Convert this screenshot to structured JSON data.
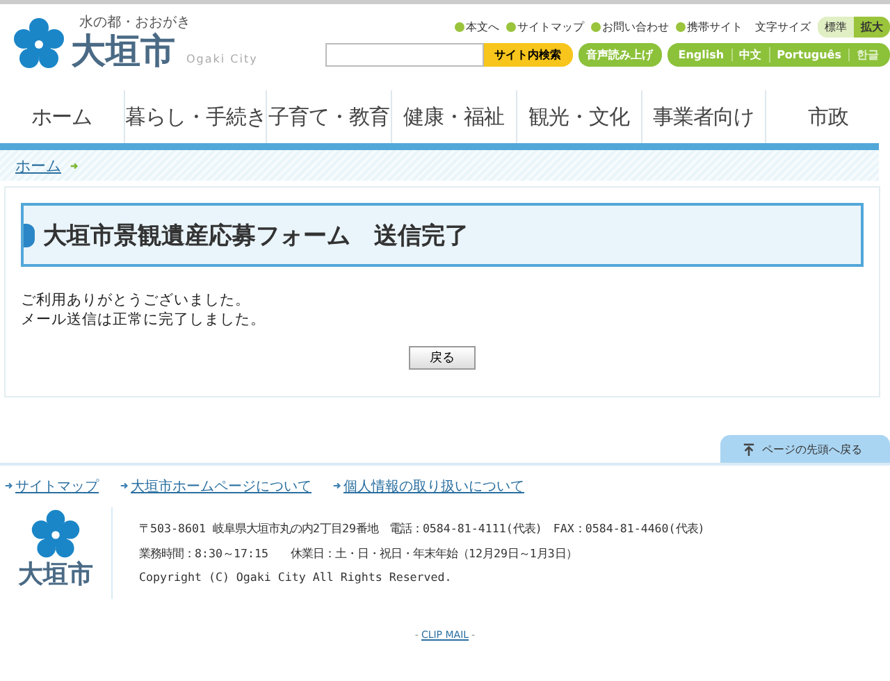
{
  "header": {
    "tagline": "水の都・おおがき",
    "logo_text": "大垣市",
    "logo_sub": "Ogaki City",
    "utility_links": [
      "本文へ",
      "サイトマップ",
      "お問い合わせ",
      "携帯サイト"
    ],
    "text_size_label": "文字サイズ",
    "text_sizes": [
      {
        "label": "標準",
        "selected": false
      },
      {
        "label": "拡大",
        "selected": true
      }
    ],
    "search_button": "サイト内検索",
    "speech_button": "音声読み上げ",
    "languages": [
      "English",
      "中文",
      "Português",
      "한글"
    ]
  },
  "nav": [
    "ホーム",
    "暮らし・手続き",
    "子育て・教育",
    "健康・福祉",
    "観光・文化",
    "事業者向け",
    "市政"
  ],
  "breadcrumb": [
    "ホーム"
  ],
  "heading": "大垣市景観遺産応募フォーム　送信完了",
  "messages": [
    "ご利用ありがとうございました。",
    "メール送信は正常に完了しました。"
  ],
  "back_button": "戻る",
  "page_top": "ページの先頭へ戻る",
  "footer_links": [
    "サイトマップ",
    "大垣市ホームページについて",
    "個人情報の取り扱いについて"
  ],
  "footer_logo_text": "大垣市",
  "footer_lines": [
    "〒503-8601 岐阜県大垣市丸の内2丁目29番地　電話：0584-81-4111(代表)　FAX：0584-81-4460(代表)",
    "業務時間：8:30～17:15　　休業日：土・日・祝日・年末年始（12月29日～1月3日）",
    "Copyright (C) Ogaki City All Rights Reserved."
  ],
  "clip_mail": "CLIP MAIL",
  "clip_mail_dashes": [
    "-",
    "-"
  ]
}
